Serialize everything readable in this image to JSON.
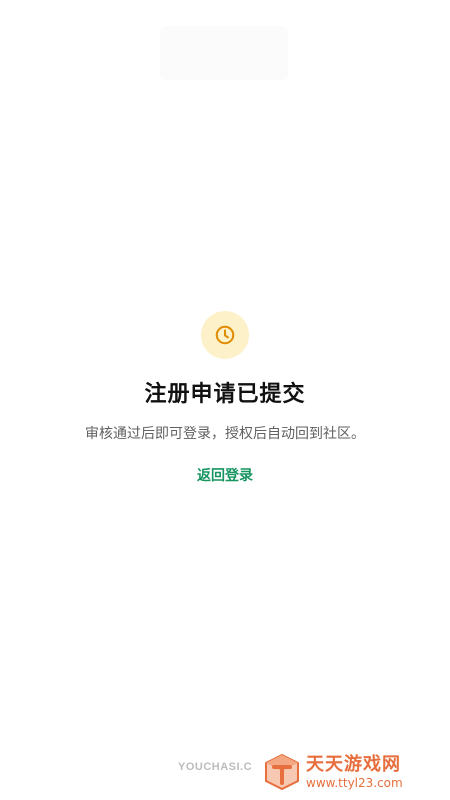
{
  "status": {
    "icon": "clock-icon",
    "icon_color": "#e08b00",
    "icon_bg": "#fdf1c9",
    "title": "注册申请已提交",
    "description": "审核通过后即可登录，授权后自动回到社区。",
    "back_link": "返回登录",
    "accent": "#179560"
  },
  "footer": {
    "domain": "YOUCHASI.C"
  },
  "watermark": {
    "title": "天天游戏网",
    "url": "www.ttyl23.com",
    "color": "#e76f3d"
  }
}
